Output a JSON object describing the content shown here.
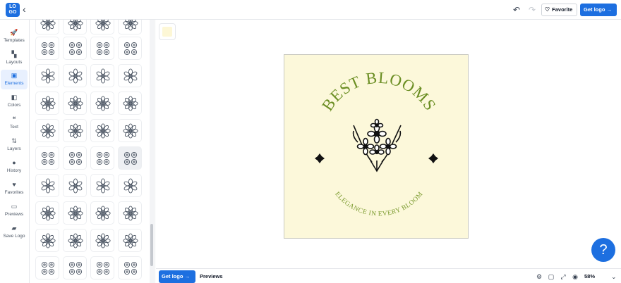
{
  "header": {
    "logo_text": "LOGO",
    "favorite_label": "Favorite",
    "get_logo_label": "Get logo →"
  },
  "nav": [
    {
      "label": "Templates",
      "icon": "rocket-icon",
      "glyph": "🚀"
    },
    {
      "label": "Layouts",
      "icon": "layouts-icon",
      "glyph": "▚"
    },
    {
      "label": "Elements",
      "icon": "image-icon",
      "glyph": "▣"
    },
    {
      "label": "Colors",
      "icon": "palette-icon",
      "glyph": "◧"
    },
    {
      "label": "Text",
      "icon": "text-icon",
      "glyph": "❝"
    },
    {
      "label": "Layers",
      "icon": "layers-icon",
      "glyph": "⇅"
    },
    {
      "label": "History",
      "icon": "clock-icon",
      "glyph": "●"
    },
    {
      "label": "Favorites",
      "icon": "heart-icon",
      "glyph": "♥"
    },
    {
      "label": "Previews",
      "icon": "monitor-icon",
      "glyph": "▭"
    },
    {
      "label": "Save Logo",
      "icon": "folder-icon",
      "glyph": "▰"
    }
  ],
  "active_nav": "Elements",
  "logo_design": {
    "title": "BEST BLOOMS",
    "tagline": "ELEGANCE IN EVERY BLOOM",
    "background_color": "#fcf8da",
    "title_color": "#6b8e23",
    "tagline_color": "#7a9a2e",
    "icon": "flower-bouquet-icon"
  },
  "bottom": {
    "get_logo_label": "Get logo →",
    "previews_label": "Previews",
    "zoom_label": "58%"
  },
  "help_label": "?"
}
